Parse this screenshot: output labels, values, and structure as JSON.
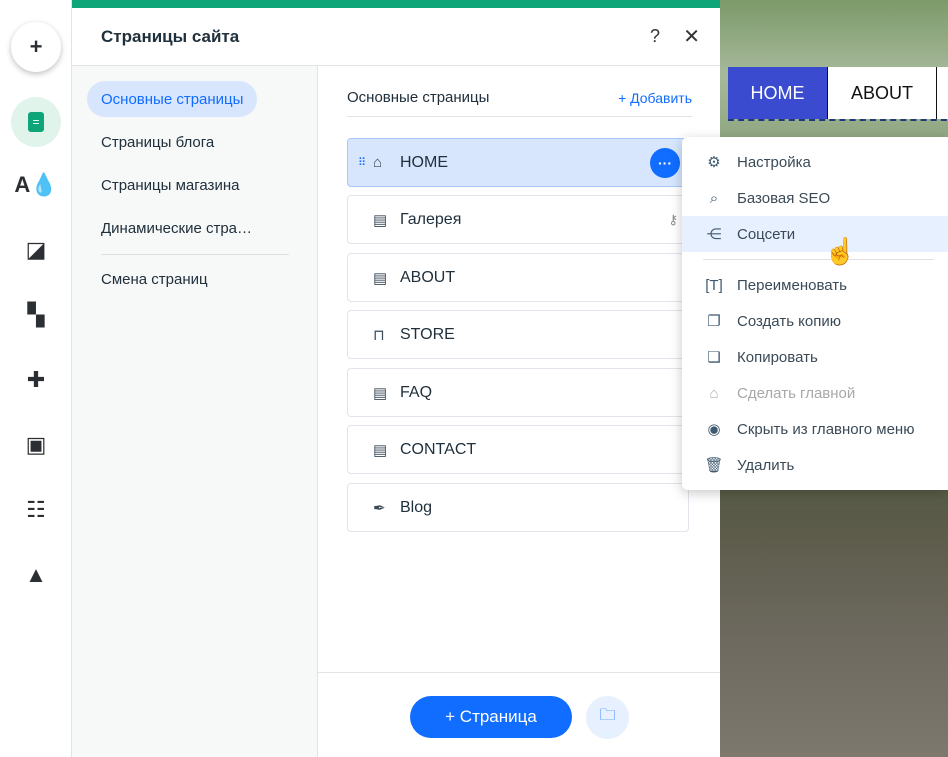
{
  "rail": {
    "icons": [
      "plus-icon",
      "pages-icon",
      "theme-icon",
      "background-icon",
      "apps-icon",
      "puzzle-icon",
      "media-icon",
      "table-icon",
      "portfolio-icon"
    ]
  },
  "panel": {
    "title": "Страницы сайта",
    "help": "?",
    "close": "✕",
    "nav": [
      {
        "label": "Основные страницы",
        "selected": true
      },
      {
        "label": "Страницы блога"
      },
      {
        "label": "Страницы магазина"
      },
      {
        "label": "Динамические стра…"
      },
      {
        "label": "Смена страниц"
      }
    ],
    "main": {
      "heading": "Основные страницы",
      "add": "+ Добавить",
      "pages": [
        {
          "label": "HOME",
          "icon": "home-icon"
        },
        {
          "label": "Галерея",
          "icon": "page-icon"
        },
        {
          "label": "ABOUT",
          "icon": "page-icon"
        },
        {
          "label": "STORE",
          "icon": "bag-icon"
        },
        {
          "label": "FAQ",
          "icon": "page-icon"
        },
        {
          "label": "CONTACT",
          "icon": "page-icon"
        },
        {
          "label": "Blog",
          "icon": "pen-icon"
        }
      ]
    },
    "footer": {
      "new_page": "+ Страница"
    }
  },
  "site": {
    "nav": [
      "HOME",
      "ABOUT"
    ],
    "accent": "#3a4bcf"
  },
  "menu": {
    "items": [
      {
        "label": "Настройка",
        "icon": "gear-icon"
      },
      {
        "label": "Базовая SEO",
        "icon": "seo-icon"
      },
      {
        "label": "Соцсети",
        "icon": "social-icon"
      },
      {
        "label": "Переименовать",
        "icon": "rename-icon"
      },
      {
        "label": "Создать копию",
        "icon": "duplicate-icon"
      },
      {
        "label": "Копировать",
        "icon": "copy-icon"
      },
      {
        "label": "Сделать главной",
        "icon": "home-icon",
        "disabled": true
      },
      {
        "label": "Скрыть из главного меню",
        "icon": "hide-icon"
      },
      {
        "label": "Удалить",
        "icon": "trash-icon"
      }
    ]
  },
  "colors": {
    "accent": "#116dff",
    "brand": "#0ea579"
  }
}
